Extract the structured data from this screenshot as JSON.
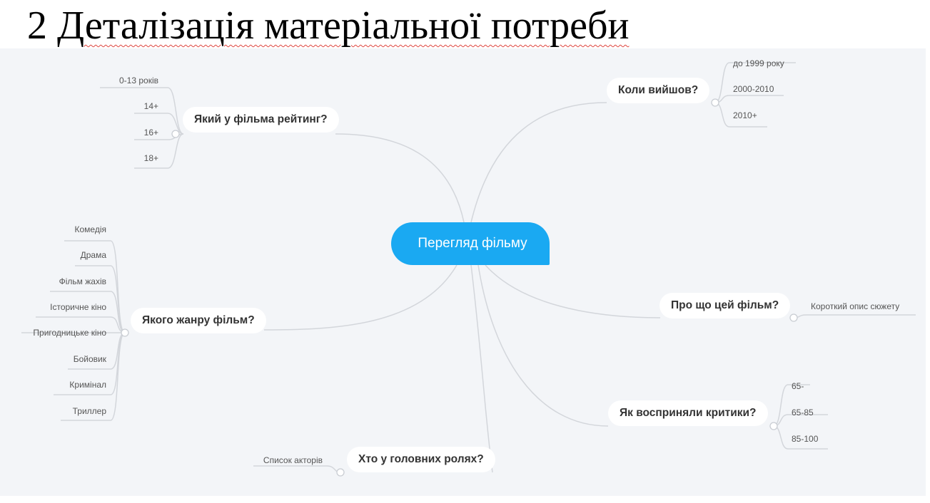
{
  "heading": {
    "number": "2",
    "text": "Деталізація матеріальної потреби"
  },
  "mindmap": {
    "root": "Перегляд фільму",
    "topics": {
      "rating": {
        "label": "Який у фільма рейтинг?",
        "leaves": [
          "0-13 років",
          "14+",
          "16+",
          "18+"
        ]
      },
      "released": {
        "label": "Коли вийшов?",
        "leaves": [
          "до 1999 року",
          "2000-2010",
          "2010+"
        ]
      },
      "genre": {
        "label": "Якого жанру фільм?",
        "leaves": [
          "Комедія",
          "Драма",
          "Фільм жахів",
          "Історичне кіно",
          "Пригодницьке кіно",
          "Бойовик",
          "Кримінал",
          "Триллер"
        ]
      },
      "about": {
        "label": "Про що цей фільм?",
        "leaves": [
          "Короткий опис сюжету"
        ]
      },
      "critics": {
        "label": "Як восприняли критики?",
        "leaves": [
          "65-",
          "65-85",
          "85-100"
        ]
      },
      "cast": {
        "label": "Хто у головних ролях?",
        "leaves": [
          "Список акторів"
        ]
      }
    },
    "colors": {
      "root": "#1aa9f2",
      "line": "#d3d6db",
      "background": "#f3f5f8"
    }
  }
}
